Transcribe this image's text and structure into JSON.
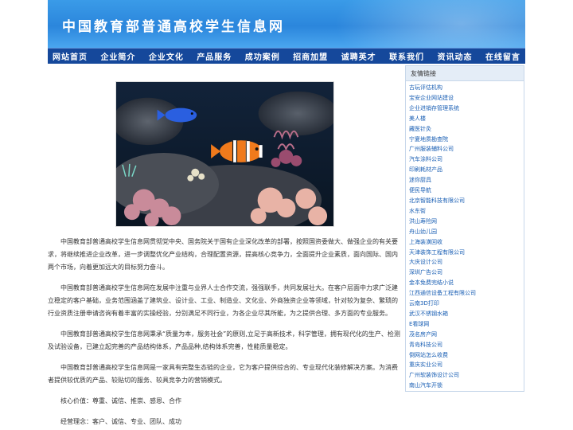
{
  "header": {
    "title": "中国教育部普通高校学生信息网"
  },
  "nav": [
    "网站首页",
    "企业简介",
    "企业文化",
    "产品服务",
    "成功案例",
    "招商加盟",
    "诚聘英才",
    "联系我们",
    "资讯动态",
    "在线留言"
  ],
  "main_image": {
    "description_icon": "aquarium-clownfish-image"
  },
  "content": {
    "p1": "中国教育部普通高校学生信息网贯彻党中央、国务院关于国有企业深化改革的部署，按照国资委做大、做强企业的有关要求，将继续推进企业改革，进一步调整优化产业结构，合理配置资源，提高核心竞争力，全面提升企业素质，面向国际、国内两个市场，向着更加远大的目标努力奋斗。",
    "p2": "中国教育部普通高校学生信息网在发展中注重与业界人士合作交流，强强联手，共同发展壮大。在客户层面中力求广泛建立稳定的客户基础，业务范围涵盖了建筑业、设计业、工业、制造业、文化业、外商独资企业等领域，针对较为复杂、繁琐的行业资质注册申请咨询有着丰富的实操经验，分别满足不同行业，为各企业尽其所能，为之提供合理、多方面的专业服务。",
    "p3": "中国教育部普通高校学生信息网秉承“质量为本，服务社会”的原则,立足于高新技术，科学管理，拥有现代化的生产、检测及试验设备，已建立起完善的产品结构体系，产品品种,结构体系完善，性能质量稳定。",
    "p4": "中国教育部普通高校学生信息网是一家具有完整生态链的企业，它为客户提供综合的、专业现代化装修解决方案。为消费者提供较优质的产品、较贴切的服务、较具竞争力的营销模式。",
    "p5": "核心价值：尊重、诚信、推崇、感恩、合作",
    "p6": "经营理念：客户、诚信、专业、团队、成功"
  },
  "sidebar": {
    "title": "友情链接",
    "links": [
      "古玩评估机构",
      "宝安企业网站建设",
      "企业进销存管理系统",
      "美人楼",
      "藏医针灸",
      "宁夏地质勘查院",
      "广州服装辅料公司",
      "汽车涂料公司",
      "印刷耗材产品",
      "迷你厨具",
      "便民导航",
      "北京智能科技有限公司",
      "水东街",
      "洪山寿险网",
      "舟山幼儿园",
      "上海装潢回收",
      "天津装饰工程有限公司",
      "大庆设计公司",
      "深圳广告公司",
      "金本免费完结小说",
      "江西通信设备工程有限公司",
      "云南3D打印",
      "武汉不锈钢水箱",
      "E看球网",
      "茂名房产网",
      "青岛科技公司",
      "倒网站怎么收费",
      "重庆实业公司",
      "广州软装饰设计公司",
      "南山汽车开锁"
    ]
  },
  "colors": {
    "header_blue": "#2b86dc",
    "nav_blue": "#15489b",
    "link_blue": "#1a5fb4"
  }
}
